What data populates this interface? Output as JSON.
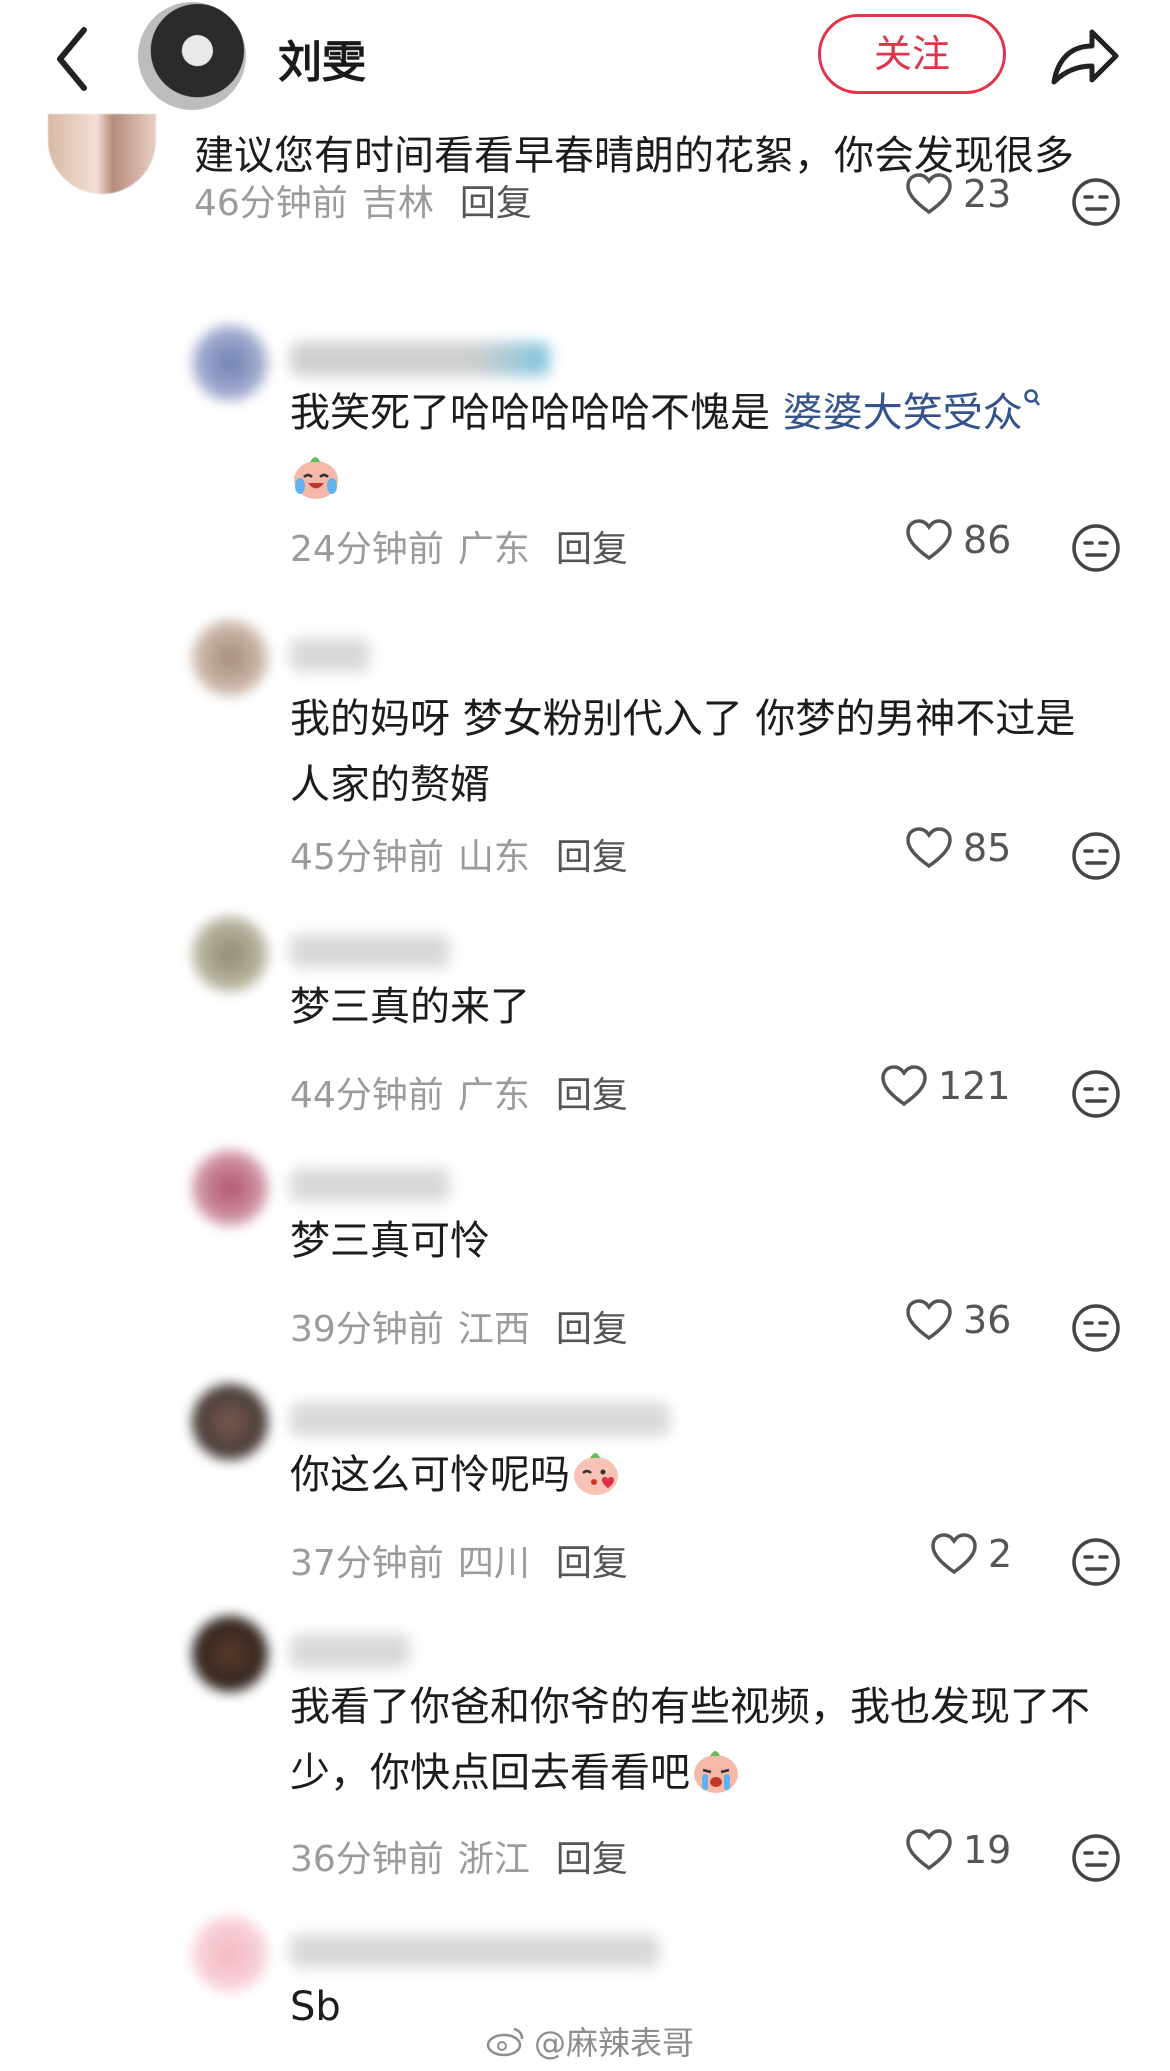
{
  "header": {
    "name": "刘雯",
    "follow_label": "关注"
  },
  "top_comment": {
    "text": "建议您有时间看看早春晴朗的花絮，你会发现很多",
    "time": "46分钟前",
    "region": "吉林",
    "reply_label": "回复",
    "likes": "23"
  },
  "replies": [
    {
      "text_before": "我笑死了哈哈哈哈哈不愧是 ",
      "topic": "婆婆大笑受众",
      "time": "24分钟前",
      "region": "广东",
      "reply_label": "回复",
      "likes": "86"
    },
    {
      "text_line1": "我的妈呀 梦女粉别代入了 你梦的男神不过是",
      "text_line2": "人家的赘婿",
      "time": "45分钟前",
      "region": "山东",
      "reply_label": "回复",
      "likes": "85"
    },
    {
      "text": "梦三真的来了",
      "time": "44分钟前",
      "region": "广东",
      "reply_label": "回复",
      "likes": "121"
    },
    {
      "text": "梦三真可怜",
      "time": "39分钟前",
      "region": "江西",
      "reply_label": "回复",
      "likes": "36"
    },
    {
      "text": "你这么可怜呢吗",
      "time": "37分钟前",
      "region": "四川",
      "reply_label": "回复",
      "likes": "2"
    },
    {
      "text_line1": "我看了你爸和你爷的有些视频，我也发现了不",
      "text_line2": "少，你快点回去看看吧",
      "time": "36分钟前",
      "region": "浙江",
      "reply_label": "回复",
      "likes": "19"
    },
    {
      "text": "Sb"
    }
  ],
  "watermark": "@麻辣表哥",
  "colors": {
    "accent": "#e0344a",
    "topic": "#34538c",
    "meta": "#9b9b9b"
  }
}
